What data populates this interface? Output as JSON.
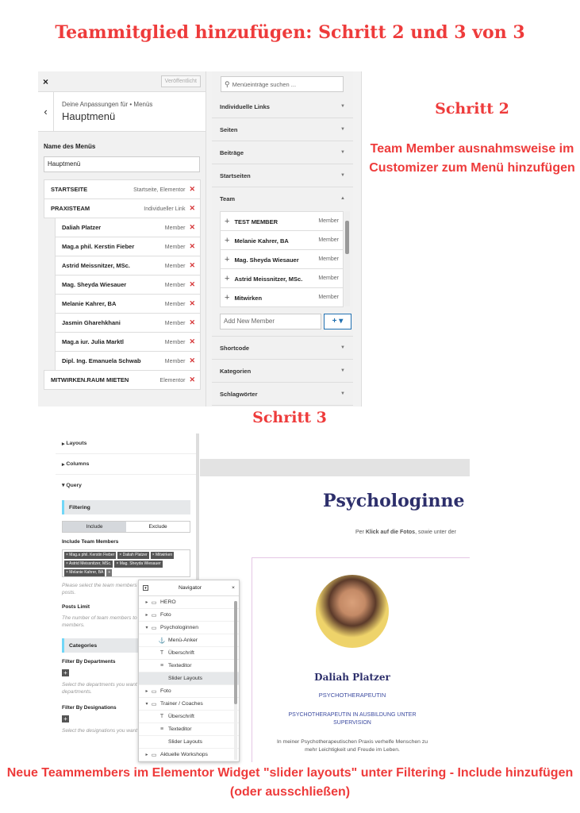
{
  "title": "Teammitglied hinzufügen:  Schritt 2 und 3 von 3",
  "customizer": {
    "close": "×",
    "publish": "Veröffentlicht",
    "back": "‹",
    "breadcrumb": "Deine Anpassungen für • Menüs",
    "menu_title": "Hauptmenü",
    "name_label": "Name des Menüs",
    "name_value": "Hauptmenü",
    "menu_items": [
      {
        "name": "STARTSEITE",
        "type": "Startseite, Elementor",
        "sub": false
      },
      {
        "name": "PRAXISTEAM",
        "type": "Individueller Link",
        "sub": false
      },
      {
        "name": "Daliah Platzer",
        "type": "Member",
        "sub": true
      },
      {
        "name": "Mag.a phil. Kerstin Fieber",
        "type": "Member",
        "sub": true
      },
      {
        "name": "Astrid Meissnitzer, MSc.",
        "type": "Member",
        "sub": true
      },
      {
        "name": "Mag. Sheyda Wiesauer",
        "type": "Member",
        "sub": true
      },
      {
        "name": "Melanie Kahrer, BA",
        "type": "Member",
        "sub": true
      },
      {
        "name": "Jasmin Gharehkhani",
        "type": "Member",
        "sub": true
      },
      {
        "name": "Mag.a iur. Julia Marktl",
        "type": "Member",
        "sub": true
      },
      {
        "name": "Dipl. Ing. Emanuela Schwab",
        "type": "Member",
        "sub": true
      },
      {
        "name": "MITWIRKEN.RAUM MIETEN",
        "type": "Elementor",
        "sub": false
      }
    ],
    "search_placeholder": "Menüeinträge suchen ...",
    "sections_top": [
      "Individuelle Links",
      "Seiten",
      "Beiträge",
      "Startseiten"
    ],
    "team_label": "Team",
    "team_items": [
      {
        "name": "TEST MEMBER",
        "type": "Member"
      },
      {
        "name": "Melanie Kahrer, BA",
        "type": "Member"
      },
      {
        "name": "Mag. Sheyda Wiesauer",
        "type": "Member"
      },
      {
        "name": "Astrid Meissnitzer, MSc.",
        "type": "Member"
      },
      {
        "name": "Mitwirken",
        "type": "Member"
      }
    ],
    "add_placeholder": "Add New Member",
    "add_button": "+ ▾",
    "sections_bottom": [
      "Shortcode",
      "Kategorien",
      "Schlagwörter"
    ]
  },
  "step2": {
    "title": "Schritt 2",
    "desc": "Team Member ausnahmsweise im Customizer zum Menü hinzufügen"
  },
  "step3": {
    "title": "Schritt 3"
  },
  "elementor": {
    "layouts": "Layouts",
    "columns": "Columns",
    "query": "Query",
    "filtering": "Filtering",
    "include": "Include",
    "exclude": "Exclude",
    "include_label": "Include Team Members",
    "tags": [
      "× Mag.a phil. Kerstin Fieber",
      "× Daliah Platzer",
      "× Mitwirken",
      "× Astrid Meissnitzer, MSc.",
      "× Mag. Sheyda Wiesauer",
      "× Melanie Kahrer, BA"
    ],
    "include_hint": "Please select the team members blank to include all posts.",
    "posts_limit": "Posts Limit",
    "posts_hint": "The number of team members to show all team members.",
    "categories": "Categories",
    "filter_departments": "Filter By Departments",
    "departments_hint": "Select the departments you want blank for all departments.",
    "filter_designations": "Filter By Designations",
    "designations_hint": "Select the designations you want"
  },
  "navigator": {
    "title": "Navigator",
    "close": "×",
    "items": [
      {
        "label": "HERO",
        "arrow": "▸",
        "icon": "▭",
        "indent": 0,
        "hl": false
      },
      {
        "label": "Foto",
        "arrow": "▸",
        "icon": "▭",
        "indent": 0,
        "hl": false
      },
      {
        "label": "Psychologinnen",
        "arrow": "▾",
        "icon": "▭",
        "indent": 0,
        "hl": false
      },
      {
        "label": "Menü-Anker",
        "arrow": "",
        "icon": "⚓",
        "indent": 1,
        "hl": false
      },
      {
        "label": "Überschrift",
        "arrow": "",
        "icon": "T",
        "indent": 1,
        "hl": false
      },
      {
        "label": "Texteditor",
        "arrow": "",
        "icon": "≡",
        "indent": 1,
        "hl": false
      },
      {
        "label": "Slider Layouts",
        "arrow": "",
        "icon": "",
        "indent": 1,
        "hl": true
      },
      {
        "label": "Foto",
        "arrow": "▸",
        "icon": "▭",
        "indent": 0,
        "hl": false
      },
      {
        "label": "Trainer / Coaches",
        "arrow": "▾",
        "icon": "▭",
        "indent": 0,
        "hl": false
      },
      {
        "label": "Überschrift",
        "arrow": "",
        "icon": "T",
        "indent": 1,
        "hl": false
      },
      {
        "label": "Texteditor",
        "arrow": "",
        "icon": "≡",
        "indent": 1,
        "hl": false
      },
      {
        "label": "Slider Layouts",
        "arrow": "",
        "icon": "",
        "indent": 1,
        "hl": false
      },
      {
        "label": "Aktuelle Workshops",
        "arrow": "▸",
        "icon": "▭",
        "indent": 0,
        "hl": false
      }
    ]
  },
  "preview": {
    "heading": "Psychologinne",
    "lead_pre": "Per ",
    "lead_bold": "Klick auf die Fotos",
    "lead_post": ", sowie unter der",
    "name": "Daliah Platzer",
    "role": "PSYCHOTHERAPEUTIN",
    "subrole": "PSYCHOTHERAPEUTIN IN AUSBILDUNG UNTER SUPERVISION",
    "body": "In meiner Psychotherapeutischen Praxis verhelfe Menschen zu mehr Leichtigkeit und Freude im Leben."
  },
  "footer": "Neue Teammembers im Elementor Widget \"slider layouts\" unter Filtering - Include hinzufügen (oder ausschließen)",
  "colors": {
    "accent_red": "#ee3b3b",
    "delete_red": "#d63638",
    "wp_blue": "#2271b1",
    "heading_navy": "#2d2f6b"
  }
}
